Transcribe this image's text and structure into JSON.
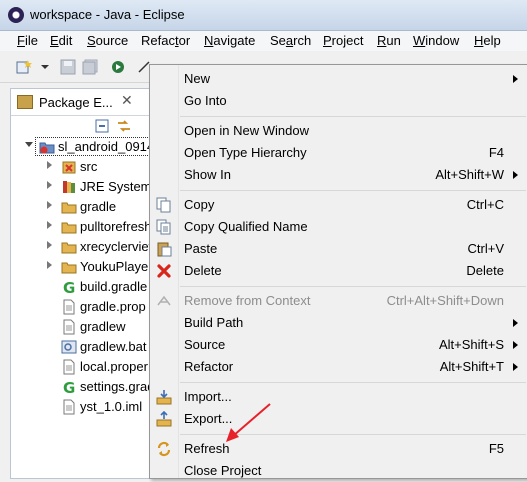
{
  "window": {
    "title": "workspace - Java - Eclipse"
  },
  "menubar": [
    {
      "label": "File",
      "mnemonic": "F"
    },
    {
      "label": "Edit",
      "mnemonic": "E"
    },
    {
      "label": "Source",
      "mnemonic": "S"
    },
    {
      "label": "Refactor",
      "mnemonic": "t"
    },
    {
      "label": "Navigate",
      "mnemonic": "N"
    },
    {
      "label": "Search",
      "mnemonic": "a"
    },
    {
      "label": "Project",
      "mnemonic": "P"
    },
    {
      "label": "Run",
      "mnemonic": "R"
    },
    {
      "label": "Window",
      "mnemonic": "W"
    },
    {
      "label": "Help",
      "mnemonic": "H"
    }
  ],
  "package_explorer": {
    "title": "Package E...",
    "tree": [
      {
        "label": "sl_android_0914",
        "kind": "project",
        "expanded": true
      },
      {
        "label": "src",
        "kind": "src-folder"
      },
      {
        "label": "JRE System",
        "kind": "library"
      },
      {
        "label": "gradle",
        "kind": "folder"
      },
      {
        "label": "pulltorefresh",
        "kind": "folder"
      },
      {
        "label": "xrecyclerview",
        "kind": "folder"
      },
      {
        "label": "YoukuPlayer",
        "kind": "folder"
      },
      {
        "label": "build.gradle",
        "kind": "gradle-file"
      },
      {
        "label": "gradle.prop",
        "kind": "text-file"
      },
      {
        "label": "gradlew",
        "kind": "text-file"
      },
      {
        "label": "gradlew.bat",
        "kind": "bat-file"
      },
      {
        "label": "local.proper",
        "kind": "text-file"
      },
      {
        "label": "settings.grad",
        "kind": "gradle-file"
      },
      {
        "label": "yst_1.0.iml",
        "kind": "text-file"
      }
    ]
  },
  "context_menu": {
    "items": [
      {
        "label": "New",
        "shortcut": "",
        "submenu": true,
        "icon": ""
      },
      {
        "label": "Go Into",
        "shortcut": "",
        "submenu": false,
        "icon": ""
      },
      {
        "label": "Open in New Window",
        "shortcut": "",
        "submenu": false,
        "icon": ""
      },
      {
        "label": "Open Type Hierarchy",
        "shortcut": "F4",
        "submenu": false,
        "icon": ""
      },
      {
        "label": "Show In",
        "shortcut": "Alt+Shift+W",
        "submenu": true,
        "icon": ""
      },
      {
        "label": "Copy",
        "shortcut": "Ctrl+C",
        "submenu": false,
        "icon": "copy-icon"
      },
      {
        "label": "Copy Qualified Name",
        "shortcut": "",
        "submenu": false,
        "icon": "copy-qualified-name-icon"
      },
      {
        "label": "Paste",
        "shortcut": "Ctrl+V",
        "submenu": false,
        "icon": "paste-icon"
      },
      {
        "label": "Delete",
        "shortcut": "Delete",
        "submenu": false,
        "icon": "delete-icon"
      },
      {
        "label": "Remove from Context",
        "shortcut": "Ctrl+Alt+Shift+Down",
        "submenu": false,
        "disabled": true,
        "icon": "remove-context-icon"
      },
      {
        "label": "Build Path",
        "shortcut": "",
        "submenu": true,
        "icon": ""
      },
      {
        "label": "Source",
        "shortcut": "Alt+Shift+S",
        "submenu": true,
        "icon": ""
      },
      {
        "label": "Refactor",
        "shortcut": "Alt+Shift+T",
        "submenu": true,
        "icon": ""
      },
      {
        "label": "Import...",
        "shortcut": "",
        "submenu": false,
        "icon": "import-icon"
      },
      {
        "label": "Export...",
        "shortcut": "",
        "submenu": false,
        "icon": "export-icon"
      },
      {
        "label": "Refresh",
        "shortcut": "F5",
        "submenu": false,
        "icon": "refresh-icon"
      },
      {
        "label": "Close Project",
        "shortcut": "",
        "submenu": false,
        "icon": ""
      }
    ]
  },
  "colors": {
    "annotation_arrow": "#e8202a",
    "title_bar": "#c6d5e8",
    "folder": "#e3b450"
  }
}
